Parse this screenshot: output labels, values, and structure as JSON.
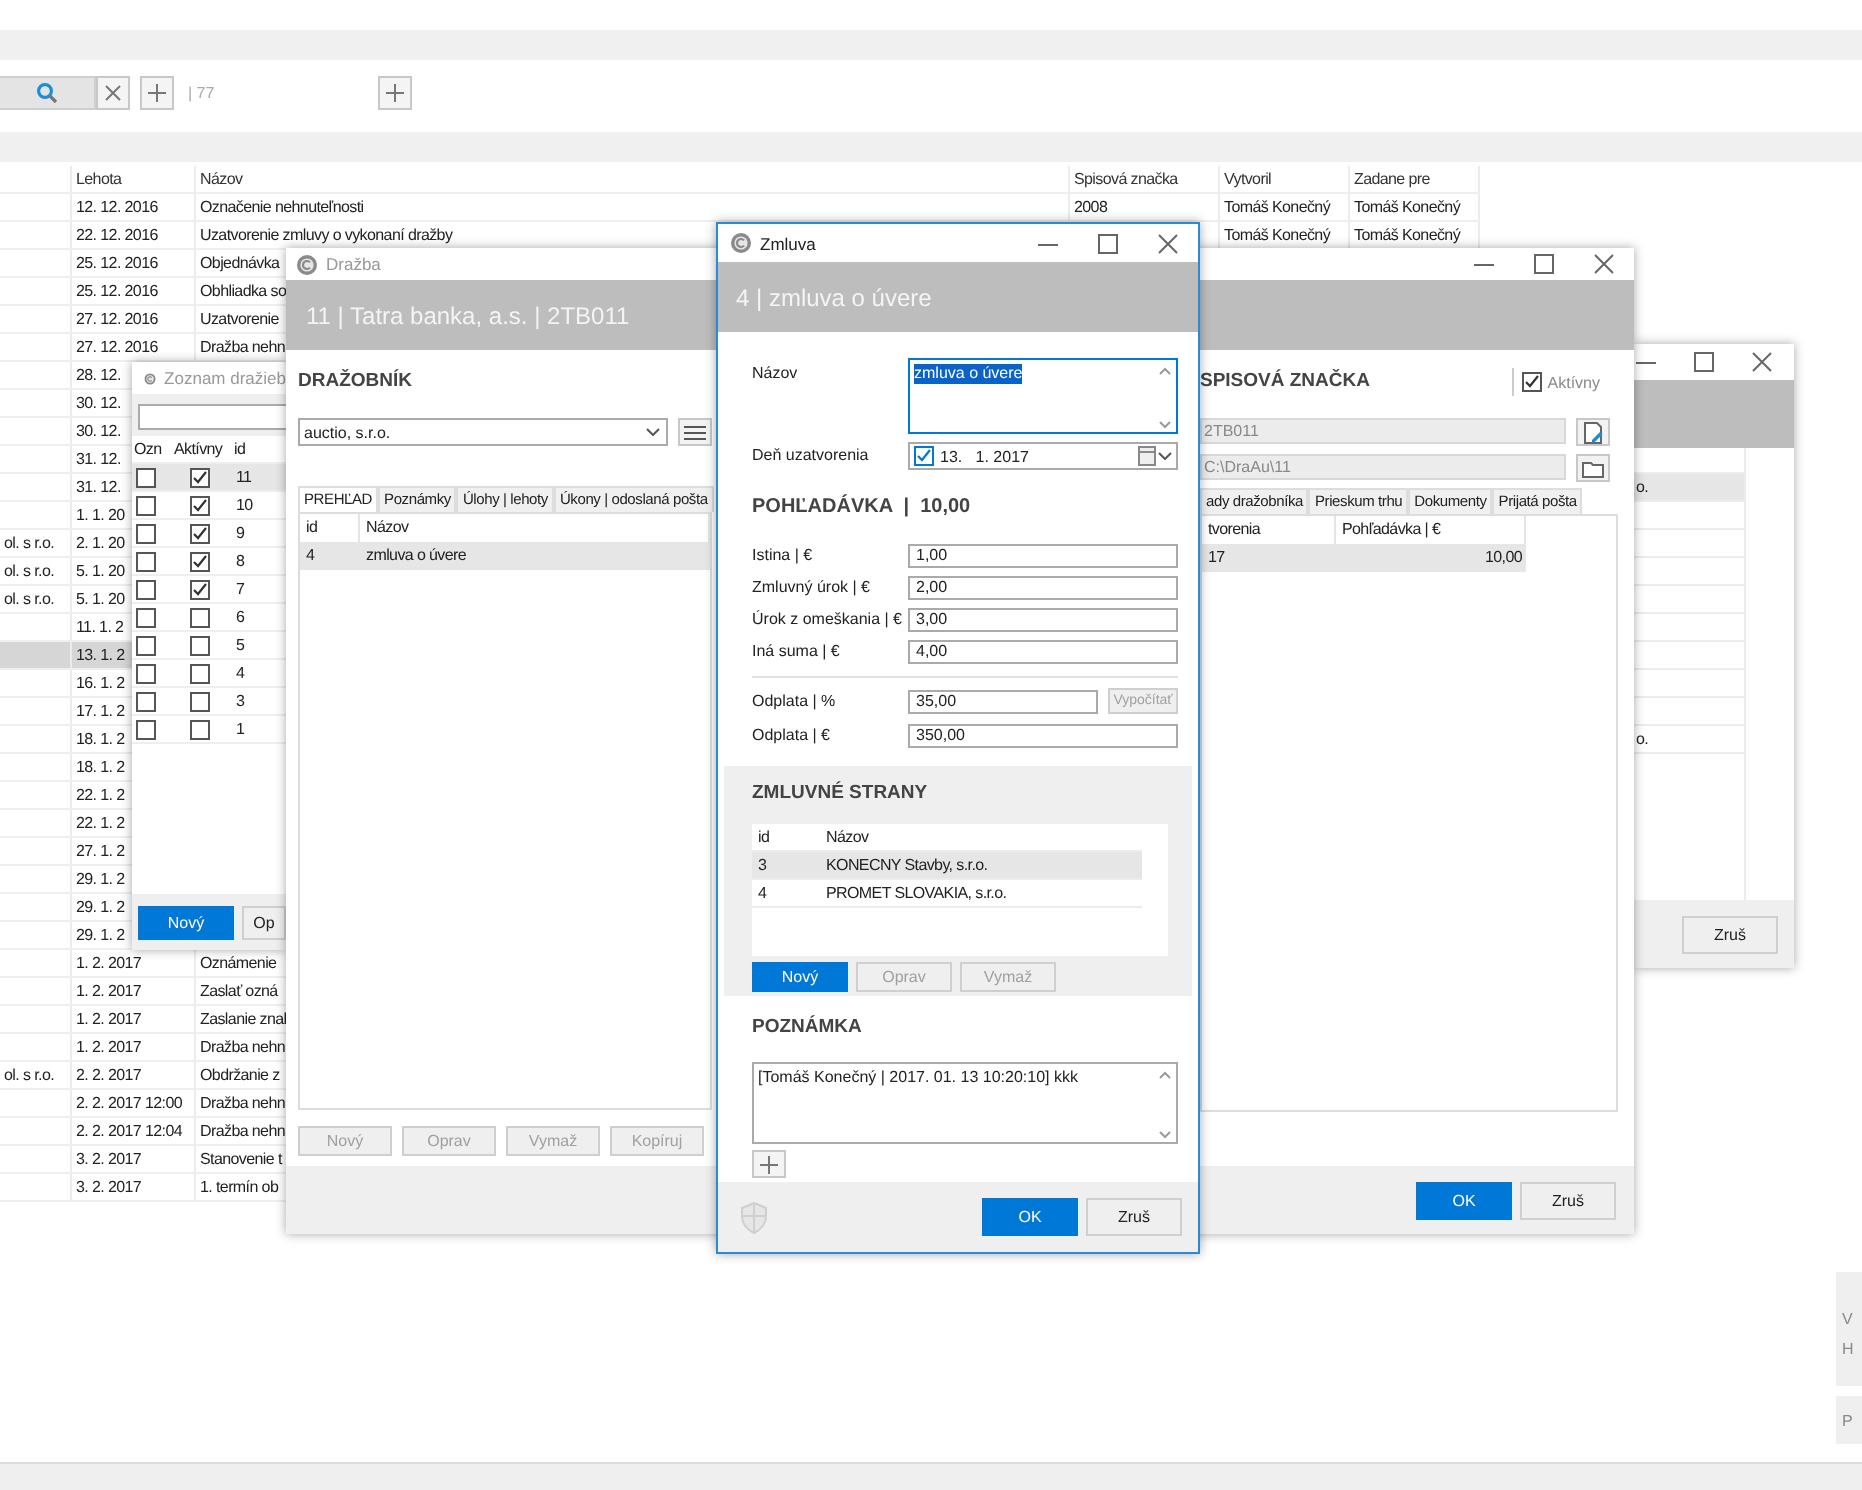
{
  "app": {
    "record_count": "| 77",
    "table": {
      "columns": [
        "Lehota",
        "Názov",
        "Spisová značka",
        "Vytvoril",
        "Zadane pre"
      ],
      "rows": [
        {
          "lehota": "12. 12. 2016",
          "nazov": "Označenie nehnuteľnosti",
          "spisova_znacka": "2008",
          "vytvoril": "Tomáš Konečný",
          "zadane_pre": "Tomáš Konečný",
          "selected": false
        },
        {
          "lehota": "22. 12. 2016",
          "nazov": "Uzatvorenie zmluvy o vykonaní dražby",
          "vytvoril": "Tomáš Konečný",
          "zadane_pre": "Tomáš Konečný",
          "selected": false
        },
        {
          "lehota": "25. 12. 2016",
          "nazov": "Objednávka",
          "selected": false
        },
        {
          "lehota": "25. 12. 2016",
          "nazov": "Obhliadka so",
          "selected": false
        },
        {
          "lehota": "27. 12. 2016",
          "nazov": "Uzatvorenie",
          "selected": false
        },
        {
          "lehota": "27. 12. 2016",
          "nazov": "Dražba nehn",
          "selected": false
        },
        {
          "lehota": "28. 12.",
          "selected": false
        },
        {
          "lehota": "30. 12.",
          "selected": false
        },
        {
          "lehota": "30. 12.",
          "selected": false
        },
        {
          "lehota": "31. 12.",
          "selected": false
        },
        {
          "lehota": "31. 12.",
          "selected": false
        },
        {
          "lehota": "1. 1. 20",
          "selected": false
        },
        {
          "column_1": "ol. s r.o.",
          "lehota": "2. 1. 20",
          "selected": false
        },
        {
          "column_1": "ol. s r.o.",
          "lehota": "5. 1. 20",
          "selected": false
        },
        {
          "column_1": "ol. s r.o.",
          "lehota": "5. 1. 20",
          "selected": false
        },
        {
          "lehota": "11. 1. 2",
          "selected": false
        },
        {
          "lehota": "13. 1. 2",
          "selected": true
        },
        {
          "lehota": "16. 1. 2",
          "selected": false
        },
        {
          "lehota": "17. 1. 2",
          "selected": false
        },
        {
          "lehota": "18. 1. 2",
          "selected": false
        },
        {
          "lehota": "18. 1. 2",
          "selected": false
        },
        {
          "lehota": "22. 1. 2",
          "selected": false
        },
        {
          "lehota": "22. 1. 2",
          "selected": false
        },
        {
          "lehota": "27. 1. 2",
          "selected": false
        },
        {
          "lehota": "29. 1. 2",
          "selected": false
        },
        {
          "lehota": "29. 1. 2",
          "selected": false
        },
        {
          "lehota": "29. 1. 2",
          "selected": false
        },
        {
          "lehota": "1. 2. 2017",
          "nazov": "Oznámenie",
          "selected": false
        },
        {
          "lehota": "1. 2. 2017",
          "nazov": "Zaslať ozná",
          "selected": false
        },
        {
          "lehota": "1. 2. 2017",
          "nazov": "Zaslanie znal",
          "selected": false
        },
        {
          "lehota": "1. 2. 2017",
          "nazov": "Dražba nehn",
          "selected": false
        },
        {
          "column_1": "ol. s r.o.",
          "lehota": "2. 2. 2017",
          "nazov": "Obdržanie z",
          "selected": false
        },
        {
          "lehota": "2. 2. 2017 12:00",
          "nazov": "Dražba nehn",
          "selected": false
        },
        {
          "lehota": "2. 2. 2017 12:04",
          "nazov": "Dražba nehn",
          "selected": false
        },
        {
          "lehota": "3. 2. 2017",
          "nazov": "Stanovenie t",
          "selected": false
        },
        {
          "lehota": "3. 2. 2017",
          "nazov": "1. termín ob",
          "selected": false
        }
      ]
    },
    "side_panels": [
      {
        "lines": [
          "V",
          "H"
        ]
      },
      {
        "lines": [
          "P"
        ]
      }
    ]
  },
  "auction_list_window": {
    "title": "Zoznam dražieb",
    "columns": [
      "Ozn",
      "Aktívny",
      "id"
    ],
    "rows": [
      {
        "marked": false,
        "active": true,
        "id": "11",
        "selected": true
      },
      {
        "marked": false,
        "active": true,
        "id": "10",
        "selected": false
      },
      {
        "marked": false,
        "active": true,
        "id": "9",
        "selected": false
      },
      {
        "marked": false,
        "active": true,
        "id": "8",
        "selected": false
      },
      {
        "marked": false,
        "active": true,
        "id": "7",
        "selected": false
      },
      {
        "marked": false,
        "active": false,
        "id": "6",
        "selected": false
      },
      {
        "marked": false,
        "active": false,
        "id": "5",
        "selected": false
      },
      {
        "marked": false,
        "active": false,
        "id": "4",
        "selected": false
      },
      {
        "marked": false,
        "active": false,
        "id": "3",
        "selected": false
      },
      {
        "marked": false,
        "active": false,
        "id": "1",
        "selected": false
      }
    ],
    "buttons": [
      {
        "label": "Nový",
        "primary": true
      },
      {
        "label": "Op",
        "primary": false
      }
    ]
  },
  "auction_window": {
    "title": "Dražba",
    "header": "11 | Tatra banka, a.s. | 2TB011",
    "auctioneer": {
      "heading": "DRAŽOBNÍK",
      "value": "auctio, s.r.o."
    },
    "file": {
      "heading": "SPISOVÁ ZNAČKA",
      "active": {
        "label": "Aktívny",
        "checked": true
      },
      "number": "2TB011",
      "path": "C:\\DraAu\\11"
    },
    "tabs_left": [
      {
        "label": "PREHĽAD",
        "selected": true
      },
      {
        "label": "Poznámky",
        "selected": false
      },
      {
        "label": "Úlohy | lehoty",
        "selected": false
      },
      {
        "label": "Úkony | odoslaná pošta",
        "selected": false
      }
    ],
    "tabs_right": [
      {
        "label": "ady dražobníka",
        "selected": false
      },
      {
        "label": "Prieskum trhu",
        "selected": false
      },
      {
        "label": "Dokumenty",
        "selected": false
      },
      {
        "label": "Prijatá pošta",
        "selected": false
      }
    ],
    "grid_left": {
      "columns": [
        "id",
        "Názov"
      ],
      "rows": [
        {
          "cells": [
            "4",
            "zmluva o úvere"
          ],
          "selected": true
        }
      ]
    },
    "grid_right": {
      "columns": [
        "tvorenia",
        "Pohľadávka | €"
      ],
      "rows": [
        {
          "cells": [
            "17",
            "10,00"
          ],
          "selected": true
        }
      ]
    },
    "buttons": [
      {
        "label": "Nový",
        "disabled": true
      },
      {
        "label": "Oprav",
        "disabled": true
      },
      {
        "label": "Vymaž",
        "disabled": true
      },
      {
        "label": "Kopíruj",
        "disabled": true
      }
    ],
    "footer_buttons": [
      {
        "label": "OK",
        "primary": true
      },
      {
        "label": "Zruš",
        "primary": false
      }
    ]
  },
  "back_window": {
    "rows": [
      {
        "text": "o.",
        "selected": true
      },
      {
        "selected": false
      },
      {
        "selected": false
      },
      {
        "selected": false
      },
      {
        "selected": false
      },
      {
        "selected": false
      },
      {
        "selected": false
      },
      {
        "selected": false
      },
      {
        "selected": false
      },
      {
        "text": "o.",
        "selected": false
      }
    ],
    "footer_buttons": [
      {
        "label": "Zruš",
        "primary": false
      }
    ]
  },
  "contract_window": {
    "title": "Zmluva",
    "header": "4 | zmluva o úvere",
    "name": {
      "label": "Názov",
      "value": "zmluva o úvere",
      "focused": true
    },
    "date": {
      "label": "Deň uzatvorenia",
      "checked": true,
      "value": "13.   1. 2017"
    },
    "claim_heading": "POHĽADÁVKA  |  10,00",
    "amounts": [
      {
        "label": "Istina | €",
        "value": "1,00"
      },
      {
        "label": "Zmluvný úrok | €",
        "value": "2,00"
      },
      {
        "label": "Úrok z omeškania | €",
        "value": "3,00"
      },
      {
        "label": "Iná suma | €",
        "value": "4,00"
      }
    ],
    "fee_percent": {
      "label": "Odplata | %",
      "value": "35,00",
      "button": {
        "label": "Vypočítať",
        "disabled": true
      }
    },
    "fee_amount": {
      "label": "Odplata | €",
      "value": "350,00"
    },
    "parties": {
      "heading": "ZMLUVNÉ STRANY",
      "columns": [
        "id",
        "Názov"
      ],
      "rows": [
        {
          "cells": [
            "3",
            "KONECNY Stavby, s.r.o."
          ],
          "selected": true
        },
        {
          "cells": [
            "4",
            "PROMET SLOVAKIA, s.r.o."
          ],
          "selected": false
        }
      ],
      "buttons": [
        {
          "label": "Nový",
          "primary": true,
          "disabled": false
        },
        {
          "label": "Oprav",
          "primary": false,
          "disabled": true
        },
        {
          "label": "Vymaž",
          "primary": false,
          "disabled": true
        }
      ]
    },
    "note": {
      "heading": "POZNÁMKA",
      "value": "[Tomáš Konečný | 2017. 01. 13 10:20:10] kkk"
    },
    "footer_buttons": [
      {
        "label": "OK",
        "primary": true
      },
      {
        "label": "Zruš",
        "primary": false
      }
    ]
  }
}
